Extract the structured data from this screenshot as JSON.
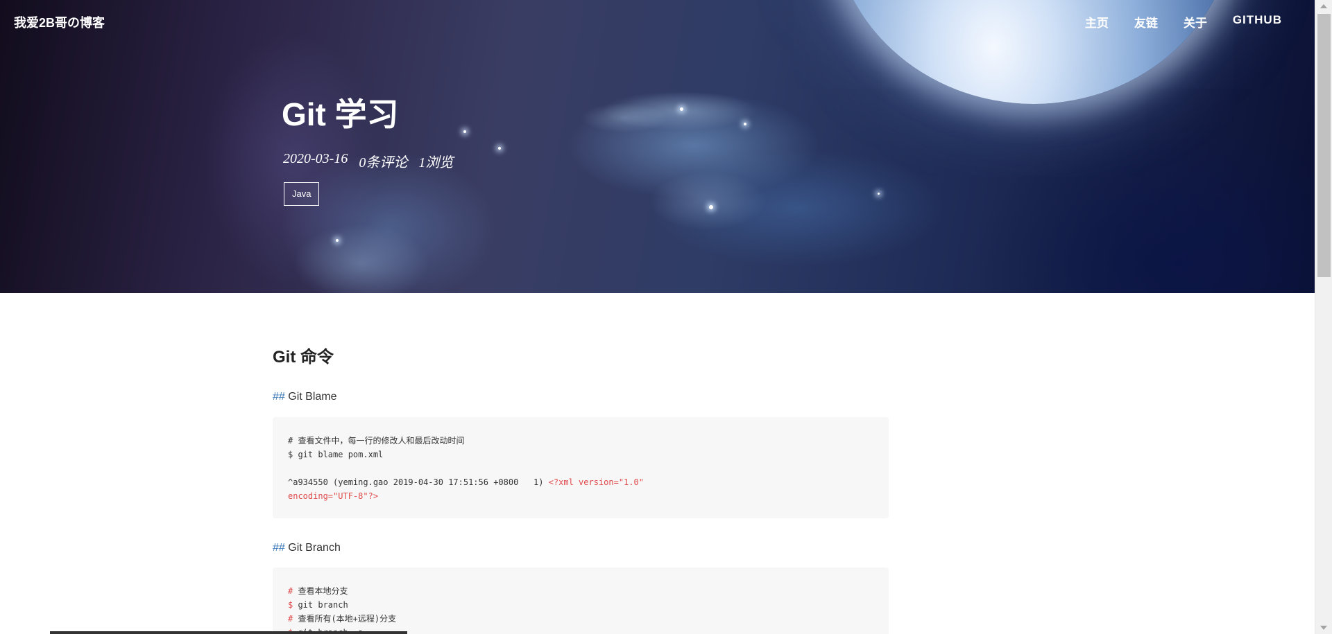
{
  "header": {
    "site_title": "我爱2B哥の博客",
    "nav": [
      {
        "label": "主页"
      },
      {
        "label": "友链"
      },
      {
        "label": "关于"
      },
      {
        "label": "GITHUB"
      }
    ]
  },
  "post": {
    "title": "Git 学习",
    "date": "2020-03-16",
    "comments": "0条评论",
    "views": "1浏览",
    "tag": "Java"
  },
  "article": {
    "heading": "Git 命令",
    "sections": [
      {
        "hash": "##",
        "title": "Git Blame",
        "code": [
          {
            "text": "# 查看文件中，每一行的修改人和最后改动时间",
            "color": "default"
          },
          {
            "text": "$ git blame pom.xml",
            "color": "default"
          },
          {
            "text": "",
            "color": "default"
          },
          {
            "text": "^a934550 (yeming.gao 2019-04-30 17:51:56 +0800   1) ",
            "extra": "<?xml version=\"1.0\"",
            "color": "default"
          },
          {
            "text": "encoding=\"UTF-8\"?>",
            "color": "red"
          }
        ]
      },
      {
        "hash": "##",
        "title": "Git Branch",
        "code": [
          {
            "prefix": "# ",
            "text": "查看本地分支"
          },
          {
            "prefix": "$ ",
            "text": "git branch"
          },
          {
            "prefix": "# ",
            "text": "查看所有(本地+远程)分支"
          },
          {
            "prefix": "$ ",
            "text": "git branch -a"
          }
        ]
      }
    ]
  },
  "colors": {
    "accent_hash": "#3d7ab8",
    "code_red": "#e0494a",
    "code_bg": "#f7f7f7"
  }
}
